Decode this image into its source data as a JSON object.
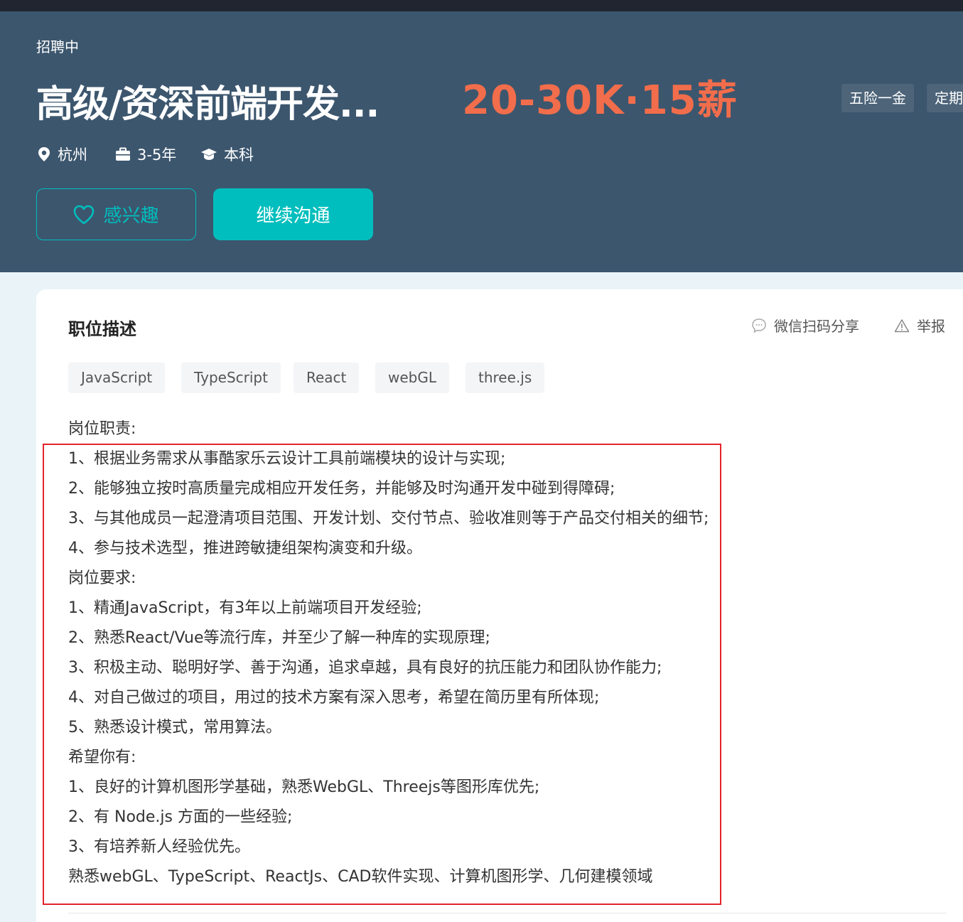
{
  "header": {
    "status": "招聘中",
    "title": "高级/资深前端开发...",
    "salary": "20-30K·15薪",
    "benefits": [
      "五险一金",
      "定期"
    ],
    "meta": {
      "city": "杭州",
      "experience": "3-5年",
      "education": "本科"
    },
    "buttons": {
      "interest": "感兴趣",
      "chat": "继续沟通"
    }
  },
  "card": {
    "section_title": "职位描述",
    "share_label": "微信扫码分享",
    "report_label": "举报",
    "tags": [
      "JavaScript",
      "TypeScript",
      "React",
      "webGL",
      "three.js"
    ],
    "description": [
      "岗位职责:",
      "1、根据业务需求从事酷家乐云设计工具前端模块的设计与实现;",
      "2、能够独立按时高质量完成相应开发任务，并能够及时沟通开发中碰到得障碍;",
      "3、与其他成员一起澄清项目范围、开发计划、交付节点、验收准则等于产品交付相关的细节;",
      "4、参与技术选型，推进跨敏捷组架构演变和升级。",
      "岗位要求:",
      "1、精通JavaScript，有3年以上前端项目开发经验;",
      "2、熟悉React/Vue等流行库，并至少了解一种库的实现原理;",
      "3、积极主动、聪明好学、善于沟通，追求卓越，具有良好的抗压能力和团队协作能力;",
      "4、对自己做过的项目，用过的技术方案有深入思考，希望在简历里有所体现;",
      "5、熟悉设计模式，常用算法。",
      "希望你有:",
      "1、良好的计算机图形学基础，熟悉WebGL、Threejs等图形库优先;",
      "2、有 Node.js 方面的一些经验;",
      "3、有培养新人经验优先。",
      "熟悉webGL、TypeScript、ReactJs、CAD软件实现、计算机图形学、几何建模领域"
    ]
  },
  "colors": {
    "header_bg": "#3c566e",
    "accent": "#00bebd",
    "salary": "#f26d4b",
    "highlight": "#e3242b"
  },
  "icons": [
    "location-pin-icon",
    "briefcase-icon",
    "graduation-cap-icon",
    "heart-icon",
    "chat-bubble-icon",
    "warning-icon"
  ]
}
